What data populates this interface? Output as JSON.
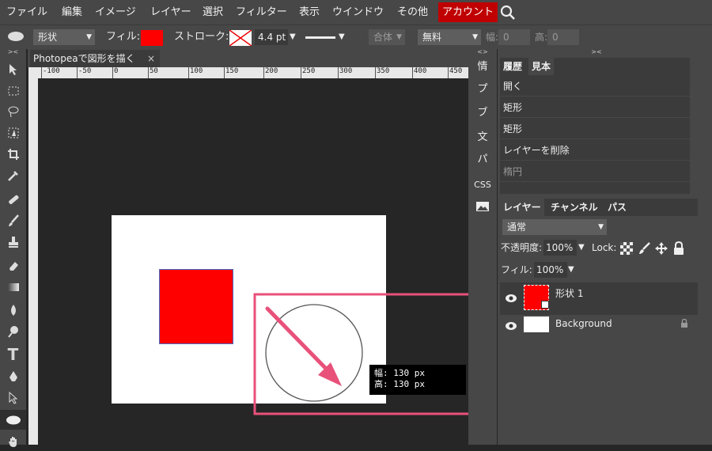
{
  "menu": {
    "items": [
      "ファイル",
      "編集",
      "イメージ",
      "レイヤー",
      "選択",
      "フィルター",
      "表示",
      "ウインドウ",
      "その他"
    ],
    "account": "アカウント"
  },
  "options": {
    "shape_mode": "形状",
    "fill_label": "フィル:",
    "fill_color": "#ff0000",
    "stroke_label": "ストローク:",
    "stroke_width": "4.4 pt",
    "combine_label": "合体",
    "style_label": "無料",
    "width_label": "幅:",
    "width_value": "0",
    "height_label": "高:",
    "height_value": "0"
  },
  "document": {
    "tab_title": "Photopeaで図形を描く",
    "ruler_ticks": [
      "-100",
      "-50",
      "0",
      "50",
      "100",
      "150",
      "200",
      "250",
      "300",
      "350",
      "400",
      "450"
    ]
  },
  "size_tooltip": {
    "width_line": "幅: 130 px",
    "height_line": "高: 130 px"
  },
  "mid_panel": {
    "buttons": [
      "情",
      "プ",
      "ブ",
      "文",
      "パ",
      "CSS"
    ]
  },
  "history_panel": {
    "tabs": [
      "履歴",
      "見本"
    ],
    "items": [
      "開く",
      "矩形",
      "矩形",
      "レイヤーを削除",
      "楕円"
    ]
  },
  "layers_panel": {
    "tabs": [
      "レイヤー",
      "チャンネル",
      "パス"
    ],
    "blend_mode": "通常",
    "opacity_label": "不透明度:",
    "opacity_value": "100%",
    "lock_label": "Lock:",
    "fill_label": "フィル:",
    "fill_value": "100%",
    "layers": [
      {
        "name": "形状 1"
      },
      {
        "name": "Background"
      }
    ]
  },
  "colors": {
    "accent_red": "#ff0000",
    "account_red": "#c00000",
    "highlight_pink": "#e8517a",
    "rect_border": "#4a6cc9"
  }
}
